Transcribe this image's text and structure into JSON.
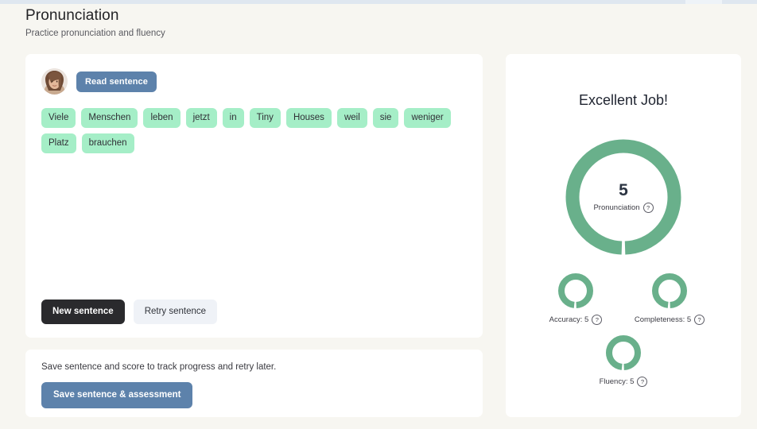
{
  "header": {
    "title": "Pronunciation",
    "subtitle": "Practice pronunciation and fluency"
  },
  "practice": {
    "avatar_name": "speaker-avatar",
    "read_button": "Read sentence",
    "words": [
      "Viele",
      "Menschen",
      "leben",
      "jetzt",
      "in",
      "Tiny",
      "Houses",
      "weil",
      "sie",
      "weniger",
      "Platz",
      "brauchen"
    ],
    "sentence": "Viele Menschen leben jetzt in Tiny Houses weil sie weniger Platz brauchen",
    "new_sentence_button": "New sentence",
    "retry_sentence_button": "Retry sentence"
  },
  "save": {
    "note": "Save sentence and score to track progress and retry later.",
    "button": "Save sentence & assessment"
  },
  "score": {
    "heading": "Excellent Job!",
    "main": {
      "value": "5",
      "label": "Pronunciation",
      "help": "?"
    },
    "metrics": [
      {
        "label": "Accuracy: 5",
        "help": "?"
      },
      {
        "label": "Completeness: 5",
        "help": "?"
      },
      {
        "label": "Fluency: 5",
        "help": "?"
      }
    ]
  },
  "chart_data": {
    "type": "pie",
    "title": "Pronunciation assessment scores",
    "categories": [
      "Pronunciation",
      "Accuracy",
      "Completeness",
      "Fluency"
    ],
    "values": [
      5,
      5,
      5,
      5
    ],
    "max_value": 5,
    "ring_color": "#69b08b",
    "track_color": "#ffffff"
  },
  "colors": {
    "page_background": "#f7f6f1",
    "card_background": "#ffffff",
    "chip": "#a5eec7",
    "accent_blue": "#5d82ab",
    "accent_dark": "#2a2a2d",
    "accent_green": "#69b08b",
    "top_strip": "#dfe7f0"
  }
}
